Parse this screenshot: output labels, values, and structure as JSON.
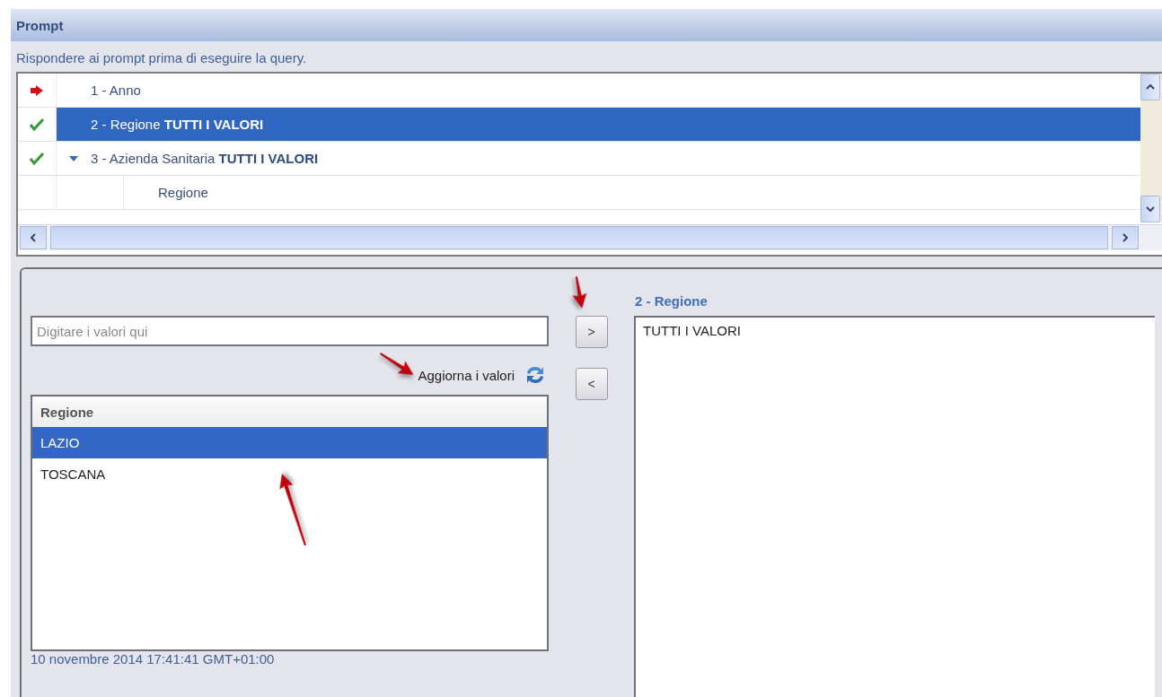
{
  "panel": {
    "title": "Prompt",
    "instructions": "Rispondere ai prompt prima di eseguire la query."
  },
  "prompts": [
    {
      "kind": "pending",
      "label": "1 - Anno",
      "selected": false
    },
    {
      "kind": "answered",
      "label": "2 - Regione **TUTTI I VALORI**",
      "selected": true
    },
    {
      "kind": "answered",
      "label": "3 - Azienda Sanitaria **TUTTI I VALORI**",
      "selected": false,
      "expanded": true,
      "children": [
        {
          "label": "Regione",
          "selected": false
        }
      ]
    }
  ],
  "search": {
    "placeholder": "Digitare i valori qui"
  },
  "refresh": {
    "label": "Aggiorna i valori"
  },
  "add_button": ">",
  "remove_button": "<",
  "available": {
    "column": "Regione",
    "items": [
      {
        "label": "LAZIO",
        "selected": true
      },
      {
        "label": "TOSCANA",
        "selected": false
      }
    ]
  },
  "timestamp": "10 novembre 2014 17:41:41 GMT+01:00",
  "selected_values": {
    "title": "2 - Regione",
    "items": [
      "TUTTI I VALORI"
    ]
  }
}
